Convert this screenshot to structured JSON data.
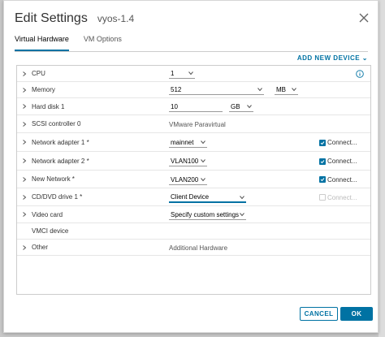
{
  "dialog": {
    "title": "Edit Settings",
    "vm_name": "vyos-1.4",
    "tabs": [
      {
        "label": "Virtual Hardware",
        "active": true
      },
      {
        "label": "VM Options",
        "active": false
      }
    ],
    "add_device_label": "ADD NEW DEVICE ⌄",
    "cancel_label": "CANCEL",
    "ok_label": "OK"
  },
  "rows": {
    "cpu": {
      "label": "CPU",
      "value": "1"
    },
    "memory": {
      "label": "Memory",
      "value": "512",
      "unit": "MB"
    },
    "hard_disk": {
      "label": "Hard disk 1",
      "value": "10",
      "unit": "GB"
    },
    "scsi": {
      "label": "SCSI controller 0",
      "value": "VMware Paravirtual"
    },
    "net1": {
      "label": "Network adapter 1 *",
      "value": "mainnet",
      "connect": "Connect...",
      "checked": true
    },
    "net2": {
      "label": "Network adapter 2 *",
      "value": "VLAN100",
      "connect": "Connect...",
      "checked": true
    },
    "newnet": {
      "label": "New Network *",
      "value": "VLAN200",
      "connect": "Connect...",
      "checked": true
    },
    "cdvd": {
      "label": "CD/DVD drive 1 *",
      "value": "Client Device",
      "connect": "Connect...",
      "checked": false
    },
    "video": {
      "label": "Video card",
      "value": "Specify custom settings"
    },
    "vmci": {
      "label": "VMCI device"
    },
    "other": {
      "label": "Other",
      "value": "Additional Hardware"
    }
  },
  "colors": {
    "accent": "#0072a3",
    "backdrop": "#c9c9c9"
  },
  "icons": [
    "close-icon",
    "chevron-right-icon",
    "chevron-down-icon",
    "checkbox-check-icon",
    "info-icon"
  ]
}
